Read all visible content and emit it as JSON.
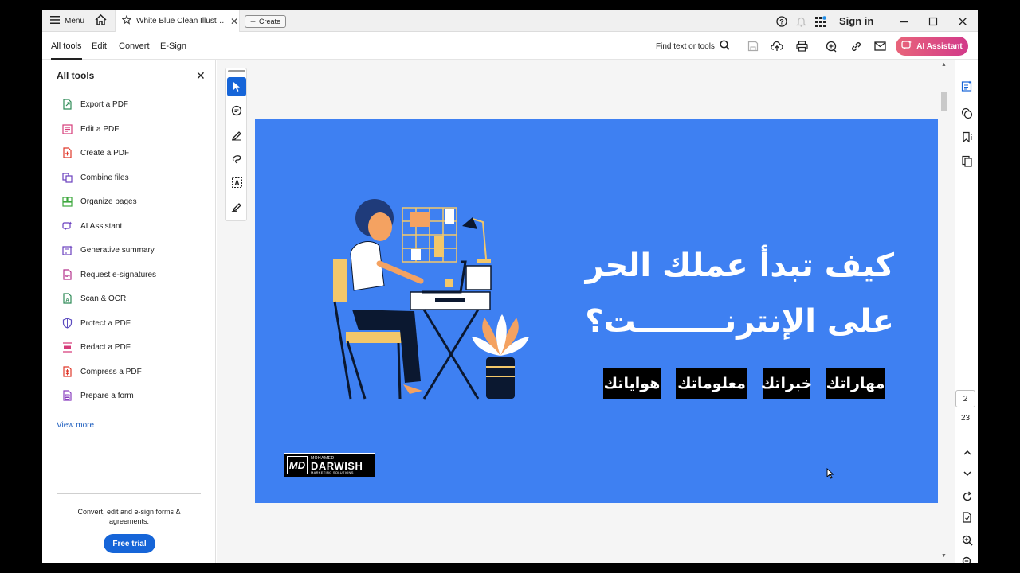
{
  "titlebar": {
    "menu_label": "Menu",
    "tab_title": "White Blue Clean Illustra...",
    "create_label": "Create",
    "sign_in": "Sign in"
  },
  "toolbar": {
    "tabs": [
      "All tools",
      "Edit",
      "Convert",
      "E-Sign"
    ],
    "find_label": "Find text or tools",
    "ai_assistant": "AI Assistant"
  },
  "left_panel": {
    "title": "All tools",
    "tools": [
      {
        "label": "Export a PDF",
        "icon": "export-pdf-icon",
        "color": "#2e8b57"
      },
      {
        "label": "Edit a PDF",
        "icon": "edit-pdf-icon",
        "color": "#d63c7a"
      },
      {
        "label": "Create a PDF",
        "icon": "create-pdf-icon",
        "color": "#e0392b"
      },
      {
        "label": "Combine files",
        "icon": "combine-files-icon",
        "color": "#6a3fbf"
      },
      {
        "label": "Organize pages",
        "icon": "organize-pages-icon",
        "color": "#3ea83e"
      },
      {
        "label": "AI Assistant",
        "icon": "ai-assistant-icon",
        "color": "#6a3fbf"
      },
      {
        "label": "Generative summary",
        "icon": "generative-summary-icon",
        "color": "#6a3fbf"
      },
      {
        "label": "Request e-signatures",
        "icon": "request-esignatures-icon",
        "color": "#b4328c"
      },
      {
        "label": "Scan & OCR",
        "icon": "scan-ocr-icon",
        "color": "#2e8b57"
      },
      {
        "label": "Protect a PDF",
        "icon": "protect-pdf-icon",
        "color": "#5b4bbf"
      },
      {
        "label": "Redact a PDF",
        "icon": "redact-pdf-icon",
        "color": "#d63c7a"
      },
      {
        "label": "Compress a PDF",
        "icon": "compress-pdf-icon",
        "color": "#e0392b"
      },
      {
        "label": "Prepare a form",
        "icon": "prepare-form-icon",
        "color": "#8a3fbf"
      }
    ],
    "view_more": "View more",
    "promo": "Convert, edit and e-sign forms & agreements.",
    "free_trial": "Free trial"
  },
  "slide": {
    "headline_1": "كيف تبدأ عملك الحر",
    "headline_2": "على الإنترنــــــــت؟",
    "pills": [
      "مهاراتك",
      "خبراتك",
      "معلوماتك",
      "هواياتك"
    ],
    "logo_monogram": "MD",
    "logo_small": "MOHAMED",
    "logo_name": "DARWISH",
    "logo_sub": "MARKETING SOLUTIONS",
    "background": "#3e80f2"
  },
  "right_rail": {
    "page_current": "2",
    "page_total": "23"
  },
  "colors": {
    "accent": "#1665d8",
    "ai_gradient_start": "#e8647a",
    "ai_gradient_end": "#d23a8a"
  }
}
